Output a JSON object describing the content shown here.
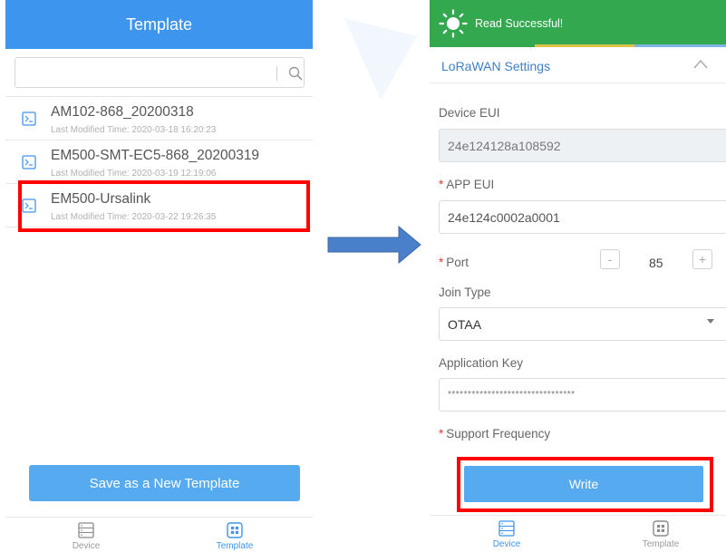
{
  "left": {
    "header": {
      "title": "Template"
    },
    "search": {
      "value": ""
    },
    "templates": [
      {
        "name": "AM102-868_20200318",
        "meta": "Last Modified Time: 2020-03-18 16:20:23"
      },
      {
        "name": "EM500-SMT-EC5-868_20200319",
        "meta": "Last Modified Time: 2020-03-19 12:19:06"
      },
      {
        "name": "EM500-Ursalink",
        "meta": "Last Modified Time: 2020-03-22 19:26:35"
      }
    ],
    "save_button": "Save as a  New Template",
    "tabs": [
      {
        "label": "Device",
        "icon": "device-icon",
        "active": false
      },
      {
        "label": "Template",
        "icon": "template-icon",
        "active": true
      }
    ]
  },
  "right": {
    "toast": {
      "message": "Read Successful!",
      "icon": "sun-icon"
    },
    "section": {
      "title": "LoRaWAN Settings",
      "icon": "chevron-up-icon"
    },
    "device_eui": {
      "label": "Device EUI",
      "value": "24e124128a108592"
    },
    "app_eui": {
      "required": "*",
      "label": "APP EUI",
      "value": "24e124c0002a0001"
    },
    "port": {
      "required": "*",
      "label": "Port",
      "minus": "-",
      "value": "85",
      "plus": "+"
    },
    "join_type": {
      "label": "Join Type",
      "value": "OTAA"
    },
    "application_key": {
      "label": "Application Key",
      "value": "********************************"
    },
    "support_frequency": {
      "required": "*",
      "label": "Support Frequency"
    },
    "write_button": "Write",
    "tabs": [
      {
        "label": "Device",
        "icon": "device-icon",
        "active": true
      },
      {
        "label": "Template",
        "icon": "template-icon",
        "active": false
      }
    ]
  },
  "colors": {
    "header_blue": "#3d95ee",
    "button_blue": "#56aaef",
    "toast_green": "#33a84e",
    "highlight_red": "#ff0000",
    "arrow_blue": "#4a7fc9"
  }
}
